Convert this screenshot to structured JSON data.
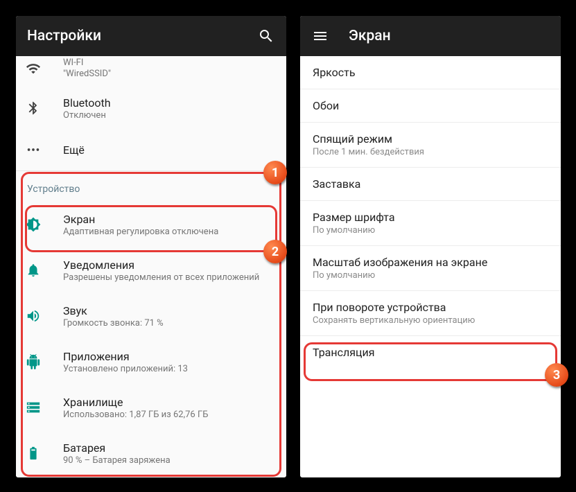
{
  "left": {
    "title": "Настройки",
    "wifi": {
      "label": "WI-FI",
      "sub": "\"WiredSSID\""
    },
    "bluetooth": {
      "label": "Bluetooth",
      "sub": "Отключен"
    },
    "more": {
      "label": "Ещё"
    },
    "device_header": "Устройство",
    "display": {
      "label": "Экран",
      "sub": "Адаптивная регулировка отключена"
    },
    "notifications": {
      "label": "Уведомления",
      "sub": "Разрешены уведомления от всех приложений"
    },
    "sound": {
      "label": "Звук",
      "sub": "Громкость звонка: 71 %"
    },
    "apps": {
      "label": "Приложения",
      "sub": "Установлено приложений: 13"
    },
    "storage": {
      "label": "Хранилище",
      "sub": "Использовано: 1,87 ГБ из 62,76 ГБ"
    },
    "battery": {
      "label": "Батарея",
      "sub": "90 % – Батарея заряжена"
    }
  },
  "right": {
    "title": "Экран",
    "brightness": {
      "label": "Яркость"
    },
    "wallpaper": {
      "label": "Обои"
    },
    "sleep": {
      "label": "Спящий режим",
      "sub": "После 1 мин. бездействия"
    },
    "screensaver": {
      "label": "Заставка"
    },
    "fontsize": {
      "label": "Размер шрифта",
      "sub": "По умолчанию"
    },
    "displaysize": {
      "label": "Масштаб изображения на экране",
      "sub": "По умолчанию"
    },
    "rotation": {
      "label": "При повороте устройства",
      "sub": "Сохранять вертикальную ориентацию"
    },
    "cast": {
      "label": "Трансляция"
    }
  },
  "badges": {
    "b1": "1",
    "b2": "2",
    "b3": "3"
  }
}
